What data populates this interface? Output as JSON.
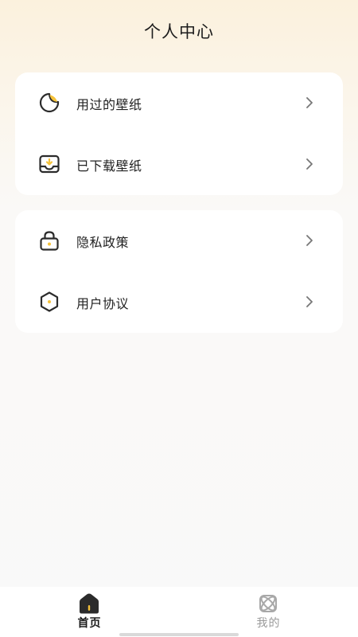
{
  "header": {
    "title": "个人中心"
  },
  "colors": {
    "accent": "#f5c23a",
    "icon_stroke": "#2b2b2b",
    "card_bg": "#ffffff"
  },
  "menu_groups": [
    {
      "items": [
        {
          "label": "用过的壁纸",
          "icon": "used-wallpaper-icon"
        },
        {
          "label": "已下载壁纸",
          "icon": "download-tray-icon"
        }
      ]
    },
    {
      "items": [
        {
          "label": "隐私政策",
          "icon": "lock-icon"
        },
        {
          "label": "用户协议",
          "icon": "hexagon-icon"
        }
      ]
    }
  ],
  "tabbar": {
    "tabs": [
      {
        "label": "首页",
        "icon": "home-icon",
        "active": true
      },
      {
        "label": "我的",
        "icon": "atom-icon",
        "active": false
      }
    ]
  }
}
